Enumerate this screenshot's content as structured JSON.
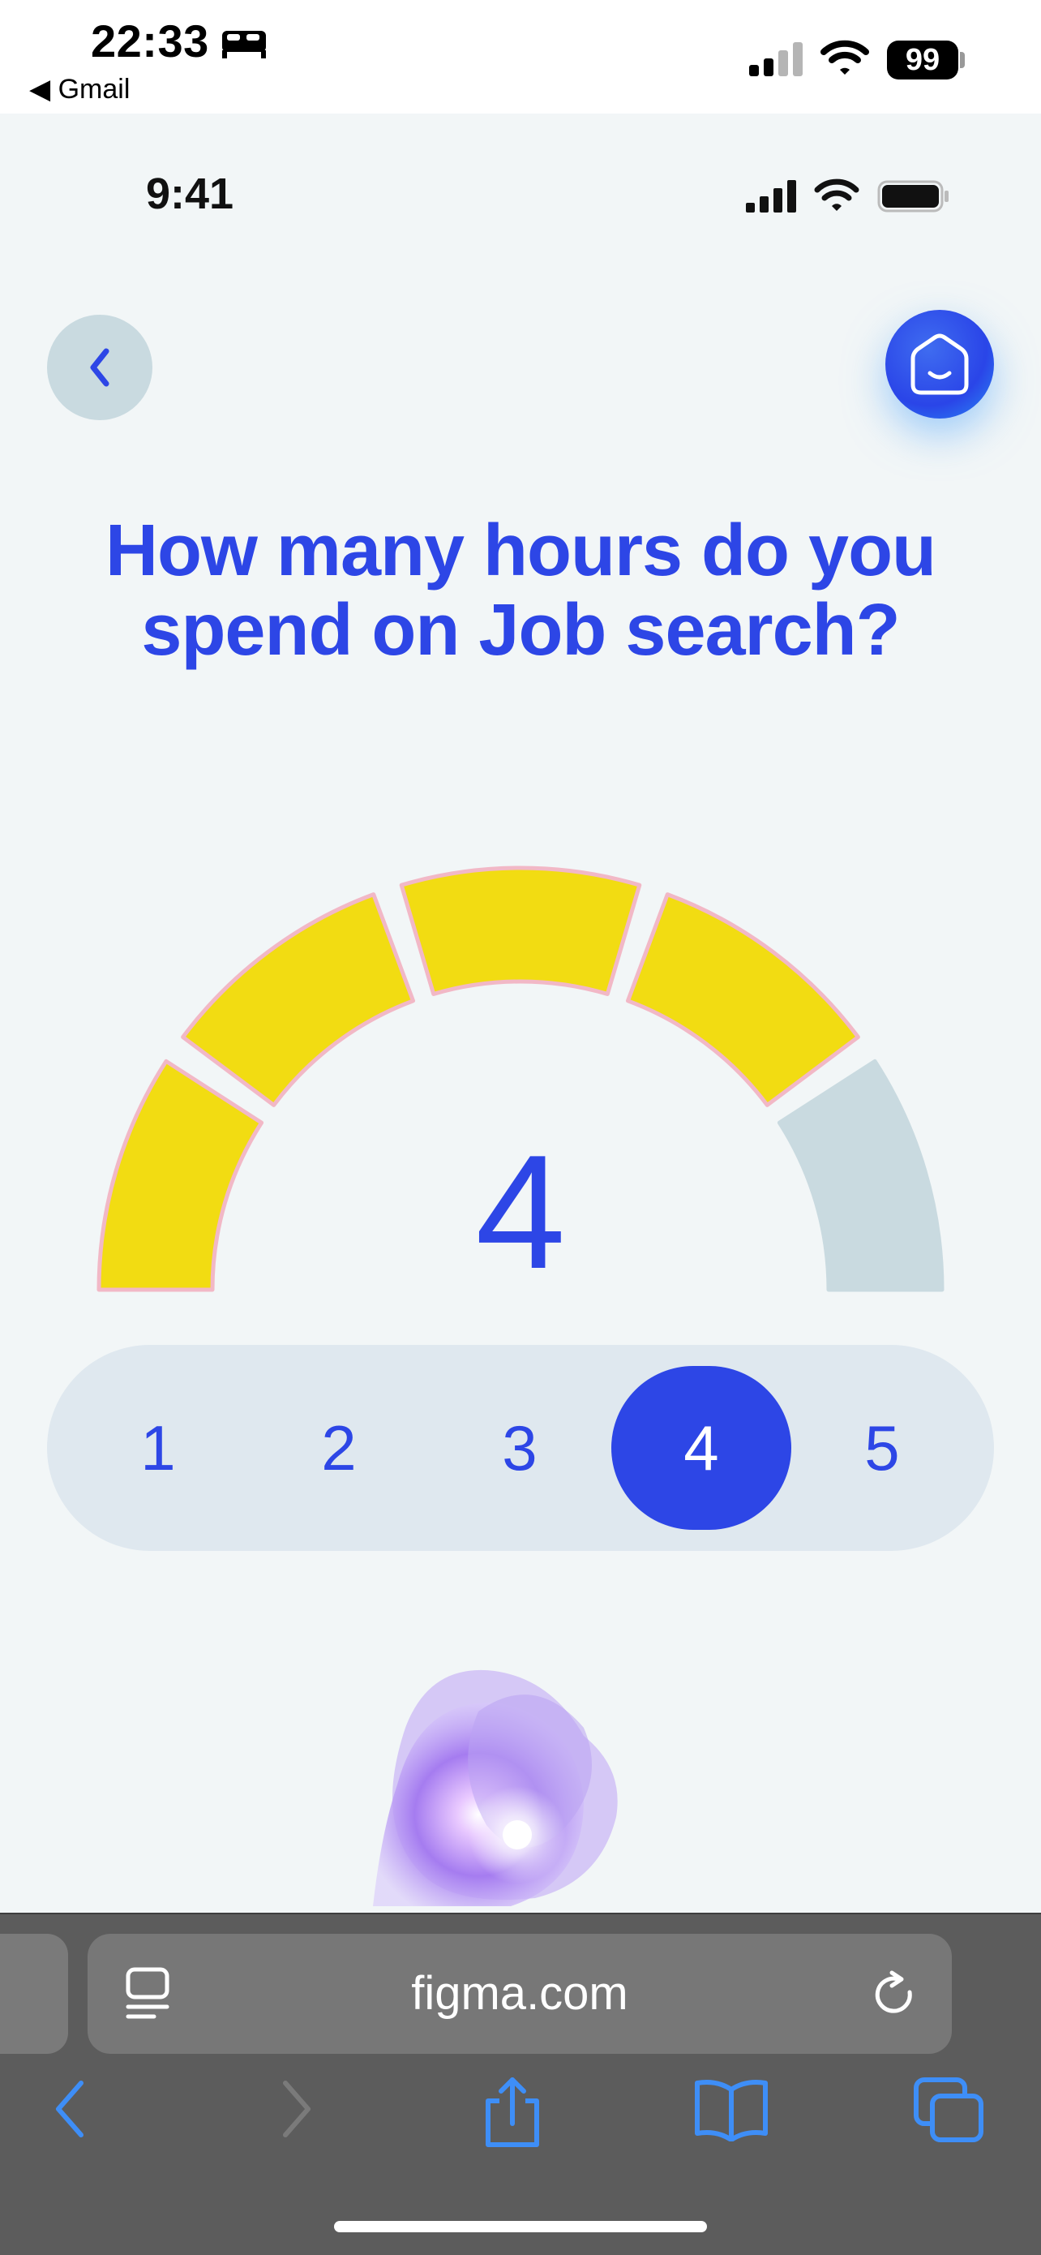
{
  "outer_status": {
    "time": "22:33",
    "back_app": "◀ Gmail",
    "battery": "99"
  },
  "inner_status": {
    "time": "9:41"
  },
  "question": {
    "line1": "How many hours do you",
    "line2": "spend on Job search?"
  },
  "gauge": {
    "value": "4",
    "segments_total": 5,
    "segments_filled": 4,
    "filled_color": "#f2dc12",
    "empty_color": "#c9dae0"
  },
  "selector": {
    "options": [
      "1",
      "2",
      "3",
      "4",
      "5"
    ],
    "selected": "4"
  },
  "browser": {
    "url": "figma.com"
  },
  "colors": {
    "accent": "#2d46e6",
    "background": "#f2f6f7"
  }
}
